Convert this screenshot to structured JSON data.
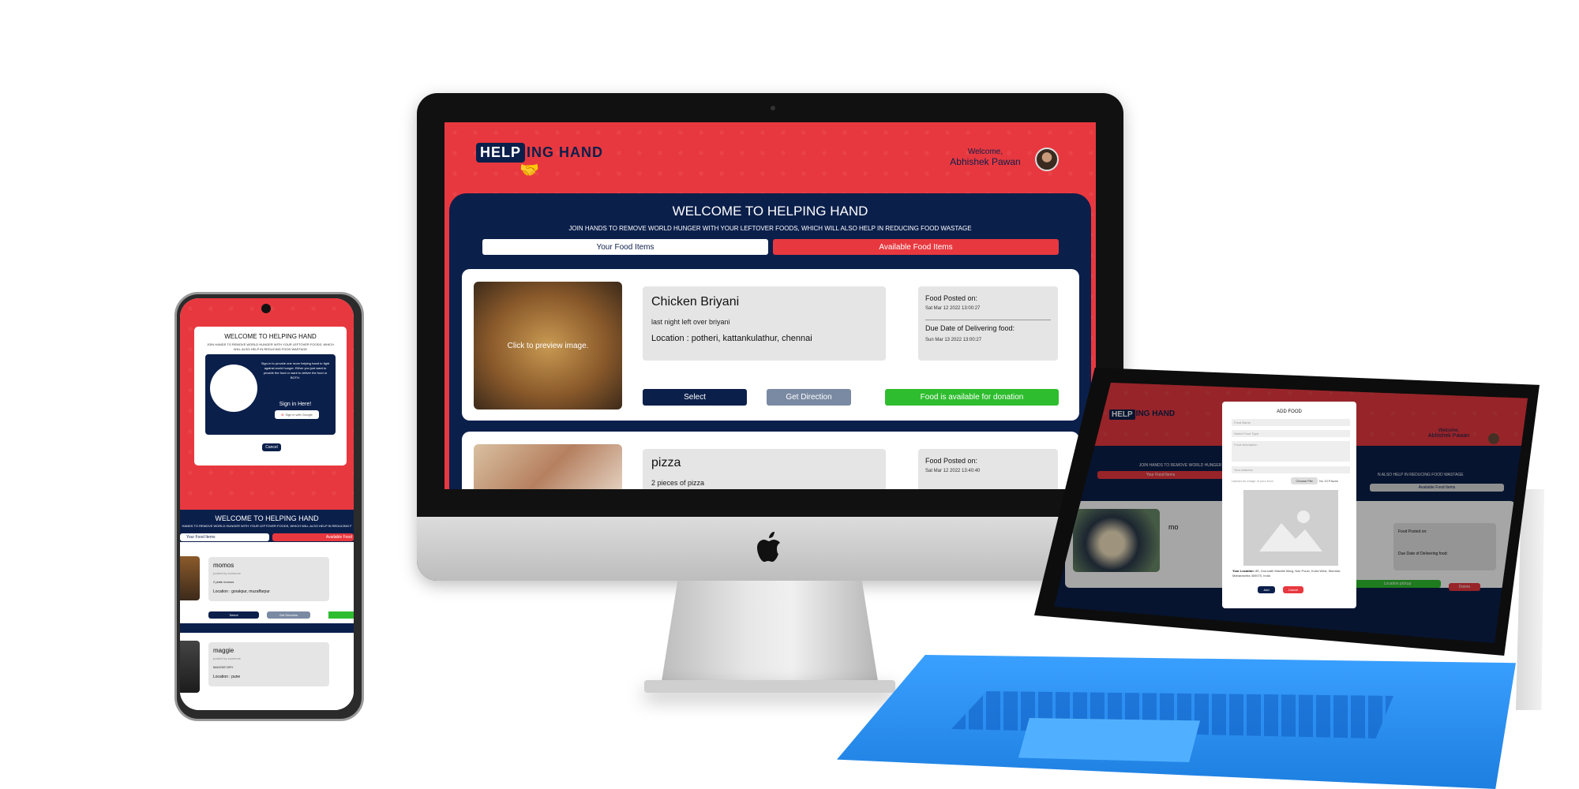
{
  "app": {
    "logo_text": "HELPING HAND",
    "logo_part1": "HELP",
    "logo_part2": "ING HAND",
    "welcome_label": "Welcome,",
    "user_name": "Abhishek Pawan"
  },
  "desktop": {
    "heading": "WELCOME TO HELPING HAND",
    "subheading": "JOIN HANDS TO REMOVE WORLD HUNGER WITH YOUR LEFTOVER FOODS, WHICH WILL ALSO HELP IN REDUCING FOOD WASTAGE",
    "tab_your": "Your Food Items",
    "tab_available": "Available Food Items",
    "items": [
      {
        "title": "Chicken Briyani",
        "description": "last night left over briyani",
        "location": "Location : potheri, kattankulathur, chennai",
        "image_caption": "Click to preview image.",
        "posted_label": "Food Posted on:",
        "posted_on": "Sat Mar 12 2022 13:00:27",
        "due_label": "Due Date of Delivering food:",
        "due_on": "Sun Mar 13 2022 13:00:27",
        "select": "Select",
        "direction": "Get Direction",
        "status": "Food is available for donation"
      },
      {
        "title": "pizza",
        "description": "2 pieces of pizza",
        "posted_label": "Food Posted on:",
        "posted_on": "Sat Mar 12 2022 13:40:40"
      }
    ]
  },
  "phone": {
    "modal_heading": "WELCOME TO HELPING HAND",
    "modal_sub": "JOIN HANDS TO REMOVE WORLD HUNGER WITH YOUR LEFTOVER FOODS, WHICH WILL ALSO HELP IN REDUCING FOOD WASTAGE",
    "signin_text": "Sign-in to provide one more helping hand to fight against world hunger. Either you just want to provide the food or want to deliver the food or BOTH.",
    "signin_heading": "Sign in Here!",
    "google_btn": "Sign in with Google",
    "cancel": "Cancel",
    "heading": "WELCOME TO HELPING HAND",
    "subheading": "HANDS TO REMOVE WORLD HUNGER WITH YOUR LEFTOVER FOODS, WHICH WILL ALSO HELP IN REDUCING F",
    "tab_your": "Your Food Items",
    "tab_available": "Available Food",
    "items": [
      {
        "title": "momos",
        "by": "posted by someone",
        "description": "2 plate momos",
        "location": "Location : gorakpur, muzaffarpur",
        "select": "Select",
        "direction": "Get Direction"
      },
      {
        "title": "maggie",
        "by": "posted by someone",
        "description": "MAGGIE DRY",
        "location": "Location : pune"
      }
    ]
  },
  "laptop": {
    "modal_title": "ADD FOOD",
    "food_name_ph": "Food Name",
    "food_type_ph": "Select Food Type",
    "food_desc_ph": "Food description",
    "address_ph": "Your Address",
    "upload_ph": "Upload an Image of your food",
    "choose_file": "Choose File",
    "file_name": "No 15.Pawan",
    "location_label": "Your Location:",
    "location_value": "85, Gurunath Marathi Marg, Nav Poulo, Kurla West, Mumbai, Maharashtra 400070, India",
    "add": "Add",
    "cancel": "Cancel",
    "item_title": "mo",
    "posted_label": "Food Posted on:",
    "due_label": "Due Date of Delivering food:",
    "status": "Location pickup",
    "delete": "Delete",
    "bg_sub": "JOIN HANDS TO REMOVE WORLD HUNGER",
    "bg_sub2": "N ALSO HELP IN REDUCING FOOD WASTAGE",
    "tab_your": "Your Food Items",
    "tab_available": "Available Food Items"
  },
  "colors": {
    "red": "#e8383f",
    "navy": "#0b1f4b",
    "green": "#2ebd2e",
    "gray_button": "#7a8aa3"
  }
}
